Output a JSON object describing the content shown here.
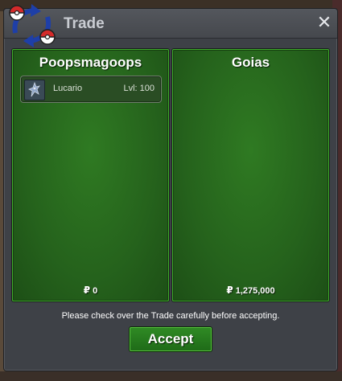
{
  "window": {
    "title": "Trade",
    "close_label": "✕"
  },
  "left_panel": {
    "player_name": "Poopsmagoops",
    "items": [
      {
        "name": "Lucario",
        "level": "Lvl: 100",
        "icon": "lucario-icon"
      }
    ],
    "money_symbol": "₽",
    "money": "0"
  },
  "right_panel": {
    "player_name": "Goias",
    "money_symbol": "₽",
    "money": "1,275,000"
  },
  "footer": {
    "notice": "Please check over the Trade carefully before accepting.",
    "accept_label": "Accept"
  },
  "colors": {
    "panel_green": "#25621c",
    "panel_border": "#3fae2a",
    "window_bg": "#3e4147"
  }
}
